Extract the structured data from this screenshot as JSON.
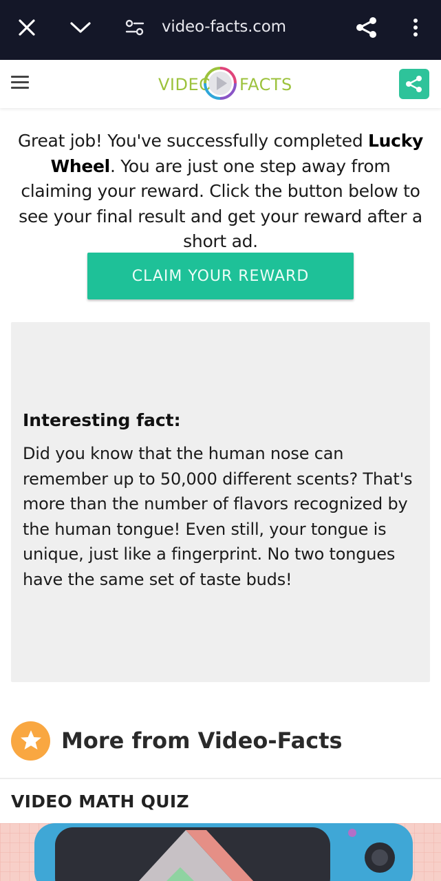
{
  "browser": {
    "url": "video-facts.com",
    "icons": [
      "close-icon",
      "chevron-down-icon",
      "site-settings-icon",
      "share-icon",
      "more-vert-icon"
    ]
  },
  "header": {
    "logo_left": "VIDEO",
    "logo_right": "FACTS",
    "colors": {
      "logo_green": "#9cc23c",
      "share_bg": "#2ec39a"
    }
  },
  "intro": {
    "part1": "Great job! You've successfully completed ",
    "game_name": "Lucky Wheel",
    "part2": ". You are just one step away from claiming your reward. Click the button below to see your final result and get your reward after a short ad."
  },
  "claim_button": {
    "label": "CLAIM YOUR REWARD",
    "color": "#1ec198"
  },
  "fact": {
    "title": "Interesting fact:",
    "text": "Did you know that the human nose can remember up to 50,000 different scents? That's more than the number of flavors recognized by the human tongue! Even still, your tongue is unique, just like a fingerprint. No two tongues have the same set of taste buds!"
  },
  "more": {
    "title": "More from Video-Facts",
    "star_color": "#f9a741"
  },
  "card": {
    "title": "VIDEO MATH QUIZ"
  }
}
